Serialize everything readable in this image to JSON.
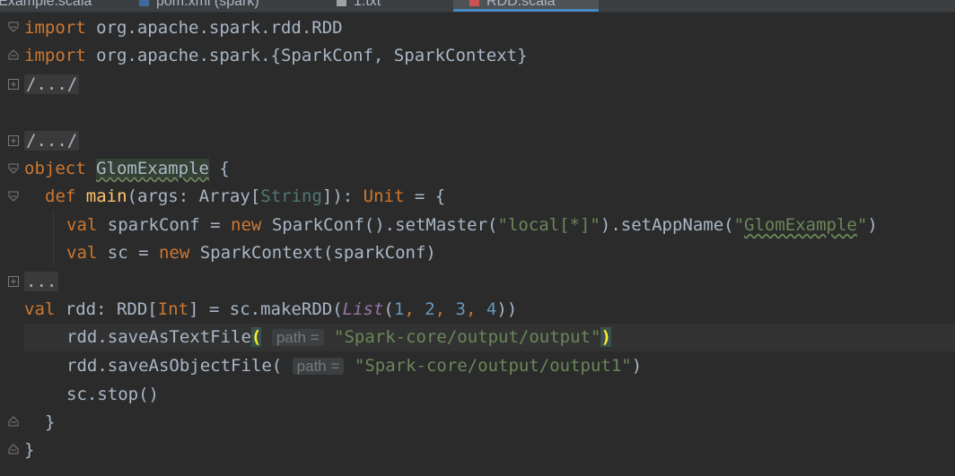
{
  "tabs": [
    {
      "label": "GlomExample.scala"
    },
    {
      "label": "pom.xml (spark)"
    },
    {
      "label": "1.txt"
    },
    {
      "label": "RDD.scala"
    }
  ],
  "code": {
    "import1": {
      "kw": "import",
      "rest": " org.apache.spark.rdd.RDD"
    },
    "import2": {
      "kw": "import",
      "rest": " org.apache.spark.{SparkConf, SparkContext}"
    },
    "fold1": "/.../",
    "fold2": "/.../",
    "object_line": {
      "kw": "object",
      "name": "GlomExample",
      "rest": " {"
    },
    "def_line": {
      "kw": "def",
      "name": "main",
      "p1": "(args: Array[",
      "tp": "String",
      "p2": "]): ",
      "unit": "Unit",
      "p3": " = {"
    },
    "conf_line": {
      "kw1": "val",
      "a": " sparkConf = ",
      "kw2": "new",
      "b": " SparkConf().setMaster(",
      "s1": "\"local[*]\"",
      "c": ").setAppName(",
      "s2q1": "\"",
      "s2": "GlomExample",
      "s2q2": "\"",
      "d": ")"
    },
    "sc_line": {
      "kw1": "val",
      "a": " sc = ",
      "kw2": "new",
      "b": " SparkContext(sparkConf)"
    },
    "fold3": "...",
    "rdd_line": {
      "kw1": "val",
      "a": " rdd: RDD[",
      "typ": "Int",
      "b": "] = sc.makeRDD(",
      "list": "List",
      "c": "(",
      "n1": "1",
      "sep1": ", ",
      "n2": "2",
      "sep2": ", ",
      "n3": "3",
      "sep3": ", ",
      "n4": "4",
      "d": "))"
    },
    "save1": {
      "a": "rdd.saveAsTextFile",
      "open": "(",
      "hint": "path =",
      "str": "\"Spark-core/output/output\"",
      "close": ")"
    },
    "save2": {
      "a": "rdd.saveAsObjectFile(",
      "hint": "path =",
      "str": "\"Spark-core/output/output1\"",
      "close": ")"
    },
    "stop_line": "sc.stop()",
    "close1": "}",
    "close2": "}"
  },
  "colors": {
    "background": "#2b2b2b",
    "keyword": "#cc7832",
    "string": "#6a8759",
    "number": "#6897bb",
    "function": "#ffc66d"
  }
}
